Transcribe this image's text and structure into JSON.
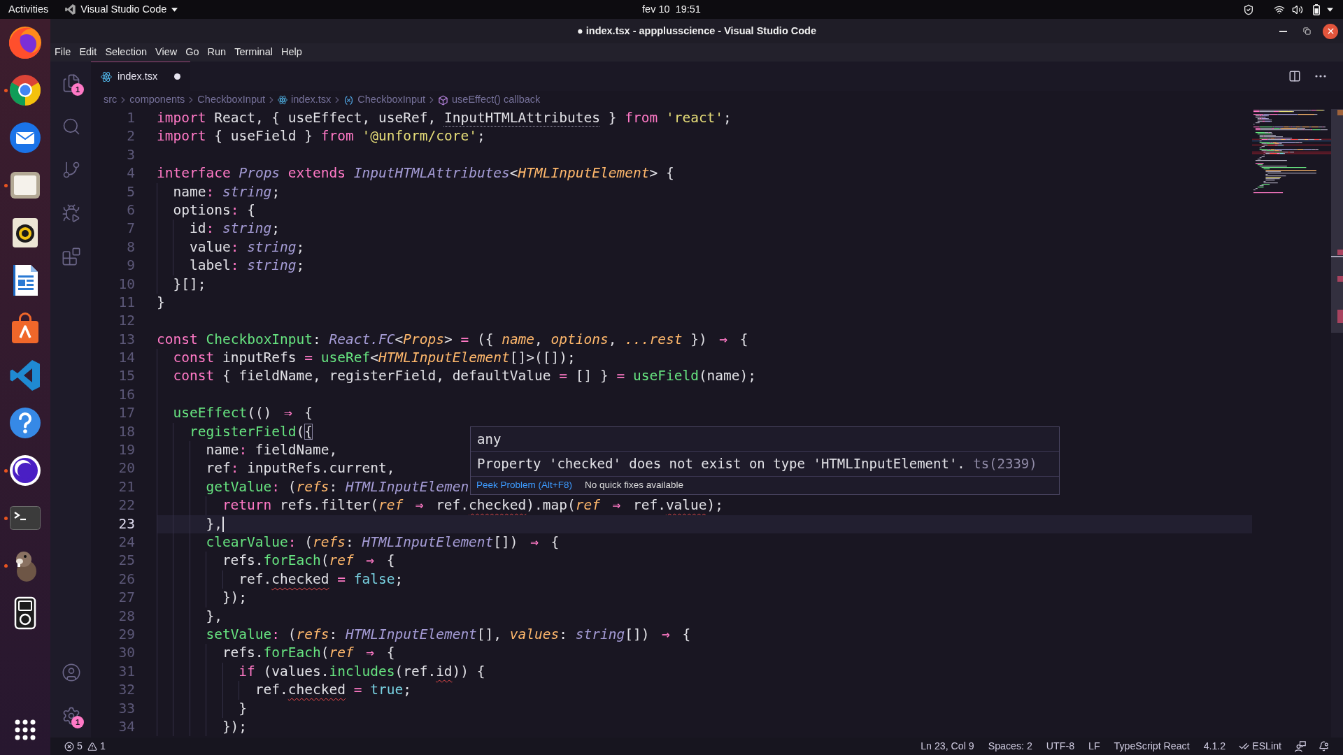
{
  "top_bar": {
    "activities": "Activities",
    "app_menu": "Visual Studio Code",
    "clock": "fev 10  19:51"
  },
  "dock": {
    "apps": [
      {
        "kind": "globe",
        "running": false
      },
      {
        "kind": "wheel",
        "running": true
      },
      {
        "kind": "mail",
        "running": false
      },
      {
        "kind": "folder",
        "running": true
      },
      {
        "kind": "speaker",
        "running": false
      },
      {
        "kind": "document",
        "running": false
      },
      {
        "kind": "bag",
        "running": false
      },
      {
        "kind": "code",
        "running": false
      },
      {
        "kind": "help",
        "running": false
      },
      {
        "kind": "moon",
        "running": true
      },
      {
        "kind": "terminal",
        "running": true
      },
      {
        "kind": "beaver",
        "running": true
      },
      {
        "kind": "player",
        "running": false
      }
    ]
  },
  "window": {
    "title": "● index.tsx - appplusscience - Visual Studio Code"
  },
  "menu_bar": [
    "File",
    "Edit",
    "Selection",
    "View",
    "Go",
    "Run",
    "Terminal",
    "Help"
  ],
  "activity_bar": {
    "top": [
      {
        "kind": "files",
        "selected": false,
        "badge": "1"
      },
      {
        "kind": "search",
        "selected": false
      },
      {
        "kind": "source-control",
        "selected": false
      },
      {
        "kind": "run",
        "selected": false
      },
      {
        "kind": "extensions",
        "selected": false
      }
    ],
    "bottom": [
      {
        "kind": "account",
        "selected": false
      },
      {
        "kind": "settings",
        "selected": false,
        "badge": "1"
      }
    ]
  },
  "tabs": [
    {
      "label": "index.tsx",
      "selected": true,
      "modified": true
    }
  ],
  "breadcrumbs": [
    {
      "label": "src",
      "kind": "folder"
    },
    {
      "label": "components",
      "kind": "folder"
    },
    {
      "label": "CheckboxInput",
      "kind": "folder"
    },
    {
      "label": "index.tsx",
      "kind": "file"
    },
    {
      "label": "CheckboxInput",
      "kind": "variable"
    },
    {
      "label": "useEffect() callback",
      "kind": "method"
    }
  ],
  "editor": {
    "lines": [
      {
        "number": "1",
        "current": false,
        "tokens": [
          {
            "text": "import",
            "kind": "keyword"
          },
          {
            "text": " React, { useEffect, useRef, ",
            "kind": "plain"
          },
          {
            "text": "InputHTMLAttributes",
            "kind": "unused"
          },
          {
            "text": " } ",
            "kind": "plain"
          },
          {
            "text": "from ",
            "kind": "keyword"
          },
          {
            "text": "'react'",
            "kind": "string"
          },
          {
            "text": ";",
            "kind": "plain"
          }
        ]
      },
      {
        "number": "2",
        "current": false,
        "tokens": [
          {
            "text": "import",
            "kind": "keyword"
          },
          {
            "text": " { useField } ",
            "kind": "plain"
          },
          {
            "text": "from ",
            "kind": "keyword"
          },
          {
            "text": "'@unform/core'",
            "kind": "string"
          },
          {
            "text": ";",
            "kind": "plain"
          }
        ]
      },
      {
        "number": "3",
        "current": false
      },
      {
        "number": "4",
        "current": false,
        "tokens": [
          {
            "text": "interface ",
            "kind": "keyword"
          },
          {
            "text": "Props ",
            "kind": "type"
          },
          {
            "text": "extends ",
            "kind": "keyword"
          },
          {
            "text": "InputHTMLAttributes",
            "kind": "type"
          },
          {
            "text": "<",
            "kind": "plain"
          },
          {
            "text": "HTMLInputElement",
            "kind": "generic"
          },
          {
            "text": "> {",
            "kind": "plain"
          }
        ]
      },
      {
        "number": "5",
        "current": false,
        "tokens": [
          {
            "text": "  name",
            "kind": "plain"
          },
          {
            "text": ": ",
            "kind": "operator"
          },
          {
            "text": "string",
            "kind": "type"
          },
          {
            "text": ";",
            "kind": "plain"
          }
        ]
      },
      {
        "number": "6",
        "current": false,
        "tokens": [
          {
            "text": "  options",
            "kind": "plain"
          },
          {
            "text": ":",
            "kind": "operator"
          },
          {
            "text": " {",
            "kind": "plain"
          }
        ]
      },
      {
        "number": "7",
        "current": false,
        "tokens": [
          {
            "text": "    id",
            "kind": "plain"
          },
          {
            "text": ": ",
            "kind": "operator"
          },
          {
            "text": "string",
            "kind": "type"
          },
          {
            "text": ";",
            "kind": "plain"
          }
        ]
      },
      {
        "number": "8",
        "current": false,
        "tokens": [
          {
            "text": "    value",
            "kind": "plain"
          },
          {
            "text": ": ",
            "kind": "operator"
          },
          {
            "text": "string",
            "kind": "type"
          },
          {
            "text": ";",
            "kind": "plain"
          }
        ]
      },
      {
        "number": "9",
        "current": false,
        "tokens": [
          {
            "text": "    label",
            "kind": "plain"
          },
          {
            "text": ": ",
            "kind": "operator"
          },
          {
            "text": "string",
            "kind": "type"
          },
          {
            "text": ";",
            "kind": "plain"
          }
        ]
      },
      {
        "number": "10",
        "current": false,
        "tokens": [
          {
            "text": "  }[];",
            "kind": "plain"
          }
        ]
      },
      {
        "number": "11",
        "current": false,
        "tokens": [
          {
            "text": "}",
            "kind": "plain"
          }
        ]
      },
      {
        "number": "12",
        "current": false
      },
      {
        "number": "13",
        "current": false,
        "tokens": [
          {
            "text": "const ",
            "kind": "keyword"
          },
          {
            "text": "CheckboxInput",
            "kind": "function"
          },
          {
            "text": ": ",
            "kind": "plain"
          },
          {
            "text": "React.FC",
            "kind": "type"
          },
          {
            "text": "<",
            "kind": "plain"
          },
          {
            "text": "Props",
            "kind": "generic"
          },
          {
            "text": "> ",
            "kind": "plain"
          },
          {
            "text": "=",
            "kind": "operator"
          },
          {
            "text": " ({ ",
            "kind": "plain"
          },
          {
            "text": "name",
            "kind": "param"
          },
          {
            "text": ", ",
            "kind": "plain"
          },
          {
            "text": "options",
            "kind": "param"
          },
          {
            "text": ", ",
            "kind": "plain"
          },
          {
            "text": "...rest",
            "kind": "param"
          },
          {
            "text": " }) ",
            "kind": "plain"
          },
          {
            "text": "⇒",
            "kind": "arrow"
          },
          {
            "text": " {",
            "kind": "plain"
          }
        ]
      },
      {
        "number": "14",
        "current": false,
        "tokens": [
          {
            "text": "  const",
            "kind": "keyword"
          },
          {
            "text": " inputRefs ",
            "kind": "plain"
          },
          {
            "text": "= ",
            "kind": "operator"
          },
          {
            "text": "useRef",
            "kind": "function"
          },
          {
            "text": "<",
            "kind": "plain"
          },
          {
            "text": "HTMLInputElement",
            "kind": "generic"
          },
          {
            "text": "[]>([]);",
            "kind": "plain"
          }
        ]
      },
      {
        "number": "15",
        "current": false,
        "tokens": [
          {
            "text": "  const",
            "kind": "keyword"
          },
          {
            "text": " { fieldName, registerField, defaultValue ",
            "kind": "plain"
          },
          {
            "text": "=",
            "kind": "operator"
          },
          {
            "text": " [] } ",
            "kind": "plain"
          },
          {
            "text": "= ",
            "kind": "operator"
          },
          {
            "text": "useField",
            "kind": "function"
          },
          {
            "text": "(name);",
            "kind": "plain"
          }
        ]
      },
      {
        "number": "16",
        "current": false
      },
      {
        "number": "17",
        "current": false,
        "tokens": [
          {
            "text": "  useEffect",
            "kind": "function"
          },
          {
            "text": "(() ",
            "kind": "plain"
          },
          {
            "text": "⇒",
            "kind": "arrow"
          },
          {
            "text": " {",
            "kind": "plain"
          }
        ]
      },
      {
        "number": "18",
        "current": false,
        "tokens": [
          {
            "text": "    registerField",
            "kind": "function"
          },
          {
            "text": "(",
            "kind": "plain"
          },
          {
            "text": "{",
            "kind": "bracket"
          }
        ]
      },
      {
        "number": "19",
        "current": false,
        "tokens": [
          {
            "text": "      name",
            "kind": "plain"
          },
          {
            "text": ":",
            "kind": "operator"
          },
          {
            "text": " fieldName,",
            "kind": "plain"
          }
        ]
      },
      {
        "number": "20",
        "current": false,
        "tokens": [
          {
            "text": "      ref",
            "kind": "plain"
          },
          {
            "text": ":",
            "kind": "operator"
          },
          {
            "text": " inputRefs.current,",
            "kind": "plain"
          }
        ]
      },
      {
        "number": "21",
        "current": false,
        "tokens": [
          {
            "text": "      getValue",
            "kind": "function"
          },
          {
            "text": ":",
            "kind": "operator"
          },
          {
            "text": " (",
            "kind": "plain"
          },
          {
            "text": "refs",
            "kind": "param"
          },
          {
            "text": ": ",
            "kind": "plain"
          },
          {
            "text": "HTMLInputElemen",
            "kind": "type"
          }
        ]
      },
      {
        "number": "22",
        "current": false,
        "tokens": [
          {
            "text": "        return",
            "kind": "keyword"
          },
          {
            "text": " refs.filter(",
            "kind": "plain"
          },
          {
            "text": "ref ",
            "kind": "param"
          },
          {
            "text": "⇒",
            "kind": "arrow"
          },
          {
            "text": " ref.",
            "kind": "plain"
          },
          {
            "text": "checked",
            "kind": "error"
          },
          {
            "text": ").map(",
            "kind": "plain"
          },
          {
            "text": "ref ",
            "kind": "param"
          },
          {
            "text": "⇒",
            "kind": "arrow"
          },
          {
            "text": " ref.",
            "kind": "plain"
          },
          {
            "text": "value",
            "kind": "error"
          },
          {
            "text": ");",
            "kind": "plain"
          }
        ]
      },
      {
        "number": "23",
        "current": true,
        "tokens": [
          {
            "text": "      },",
            "kind": "plain"
          }
        ]
      },
      {
        "number": "24",
        "current": false,
        "tokens": [
          {
            "text": "      clearValue",
            "kind": "function"
          },
          {
            "text": ":",
            "kind": "operator"
          },
          {
            "text": " (",
            "kind": "plain"
          },
          {
            "text": "refs",
            "kind": "param"
          },
          {
            "text": ": ",
            "kind": "plain"
          },
          {
            "text": "HTMLInputElement",
            "kind": "type"
          },
          {
            "text": "[]) ",
            "kind": "plain"
          },
          {
            "text": "⇒",
            "kind": "arrow"
          },
          {
            "text": " {",
            "kind": "plain"
          }
        ]
      },
      {
        "number": "25",
        "current": false,
        "tokens": [
          {
            "text": "        refs.",
            "kind": "plain"
          },
          {
            "text": "forEach",
            "kind": "function"
          },
          {
            "text": "(",
            "kind": "plain"
          },
          {
            "text": "ref ",
            "kind": "param"
          },
          {
            "text": "⇒",
            "kind": "arrow"
          },
          {
            "text": " {",
            "kind": "plain"
          }
        ]
      },
      {
        "number": "26",
        "current": false,
        "tokens": [
          {
            "text": "          ref.",
            "kind": "plain"
          },
          {
            "text": "checked",
            "kind": "error"
          },
          {
            "text": " = ",
            "kind": "operator"
          },
          {
            "text": "false",
            "kind": "literal"
          },
          {
            "text": ";",
            "kind": "plain"
          }
        ]
      },
      {
        "number": "27",
        "current": false,
        "tokens": [
          {
            "text": "        });",
            "kind": "plain"
          }
        ]
      },
      {
        "number": "28",
        "current": false,
        "tokens": [
          {
            "text": "      },",
            "kind": "plain"
          }
        ]
      },
      {
        "number": "29",
        "current": false,
        "tokens": [
          {
            "text": "      setValue",
            "kind": "function"
          },
          {
            "text": ":",
            "kind": "operator"
          },
          {
            "text": " (",
            "kind": "plain"
          },
          {
            "text": "refs",
            "kind": "param"
          },
          {
            "text": ": ",
            "kind": "plain"
          },
          {
            "text": "HTMLInputElement",
            "kind": "type"
          },
          {
            "text": "[], ",
            "kind": "plain"
          },
          {
            "text": "values",
            "kind": "param"
          },
          {
            "text": ": ",
            "kind": "plain"
          },
          {
            "text": "string",
            "kind": "type"
          },
          {
            "text": "[]) ",
            "kind": "plain"
          },
          {
            "text": "⇒",
            "kind": "arrow"
          },
          {
            "text": " {",
            "kind": "plain"
          }
        ]
      },
      {
        "number": "30",
        "current": false,
        "tokens": [
          {
            "text": "        refs.",
            "kind": "plain"
          },
          {
            "text": "forEach",
            "kind": "function"
          },
          {
            "text": "(",
            "kind": "plain"
          },
          {
            "text": "ref ",
            "kind": "param"
          },
          {
            "text": "⇒",
            "kind": "arrow"
          },
          {
            "text": " {",
            "kind": "plain"
          }
        ]
      },
      {
        "number": "31",
        "current": false,
        "tokens": [
          {
            "text": "          if",
            "kind": "keyword"
          },
          {
            "text": " (values.",
            "kind": "plain"
          },
          {
            "text": "includes",
            "kind": "function"
          },
          {
            "text": "(ref.",
            "kind": "plain"
          },
          {
            "text": "id",
            "kind": "error"
          },
          {
            "text": ")) {",
            "kind": "plain"
          }
        ]
      },
      {
        "number": "32",
        "current": false,
        "tokens": [
          {
            "text": "            ref.",
            "kind": "plain"
          },
          {
            "text": "checked",
            "kind": "error"
          },
          {
            "text": " = ",
            "kind": "operator"
          },
          {
            "text": "true",
            "kind": "literal"
          },
          {
            "text": ";",
            "kind": "plain"
          }
        ]
      },
      {
        "number": "33",
        "current": false,
        "tokens": [
          {
            "text": "          }",
            "kind": "plain"
          }
        ]
      },
      {
        "number": "34",
        "current": false,
        "tokens": [
          {
            "text": "        });",
            "kind": "plain"
          }
        ]
      }
    ]
  },
  "hover": {
    "signature": "any",
    "message": "Property 'checked' does not exist on type 'HTMLInputElement'.",
    "code": "ts(2339)",
    "action": "Peek Problem (Alt+F8)",
    "note": "No quick fixes available"
  },
  "status_bar": {
    "errors": "5",
    "warnings": "1",
    "items": [
      "Ln 23, Col 9",
      "Spaces: 2",
      "UTF-8",
      "LF",
      "TypeScript React",
      "4.1.2"
    ],
    "linter": "ESLint"
  }
}
